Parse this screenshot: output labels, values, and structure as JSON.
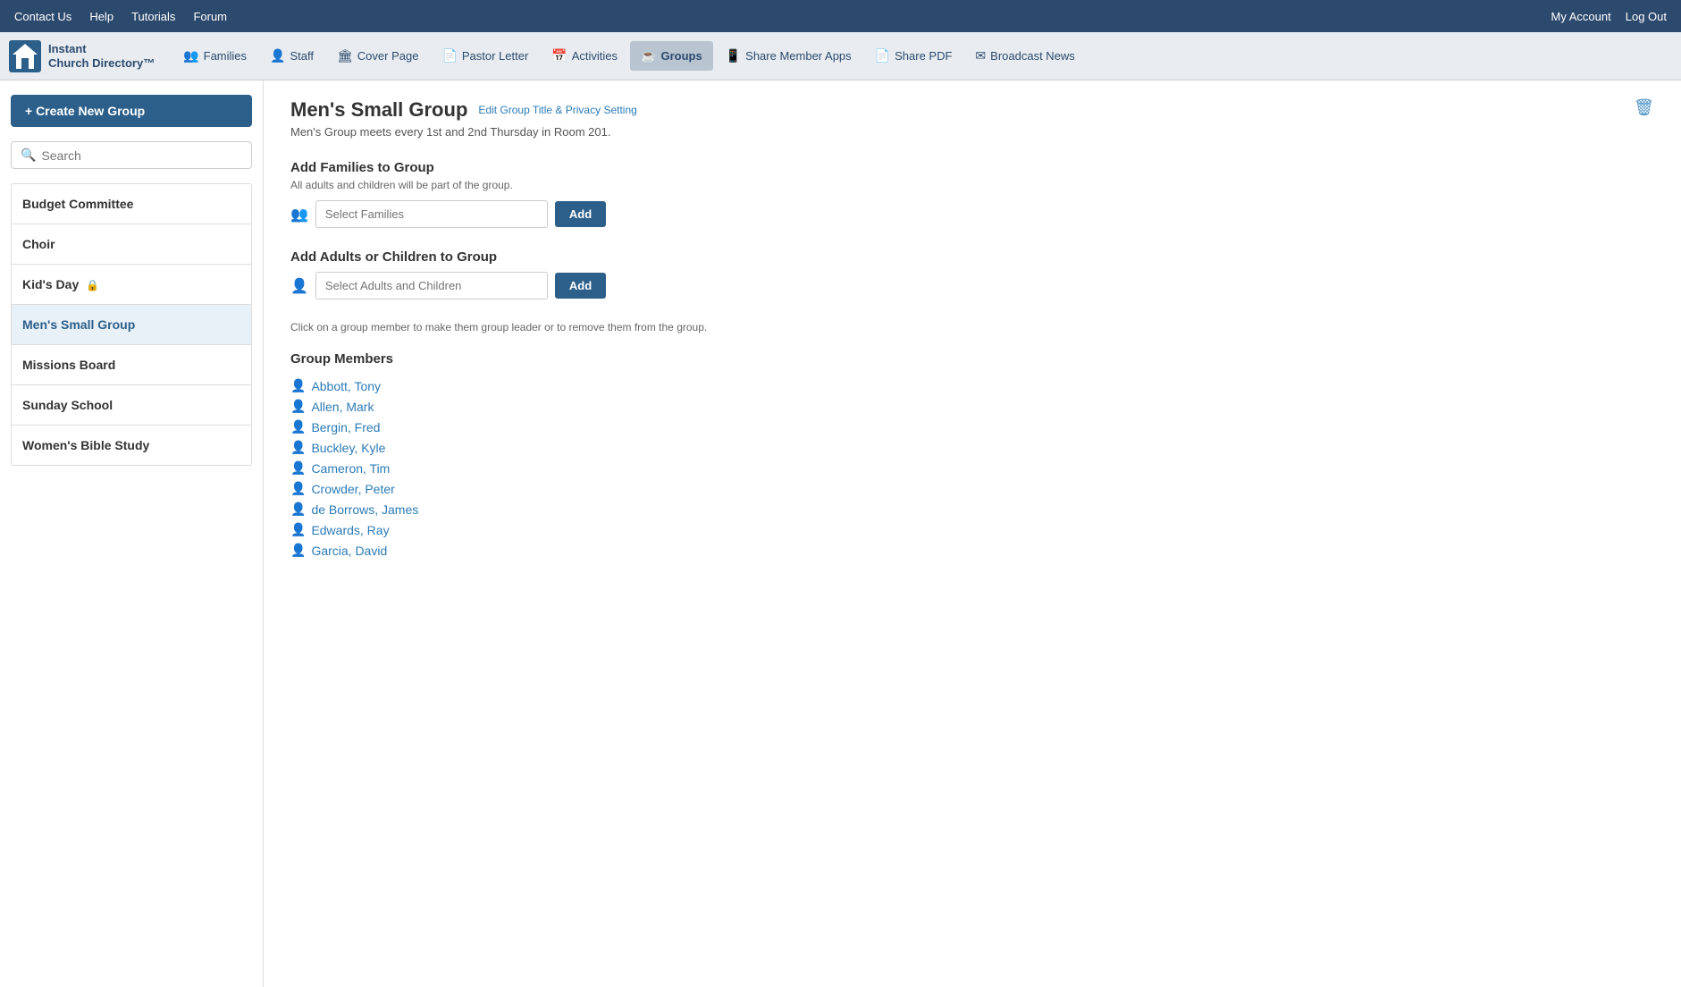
{
  "topNav": {
    "left": [
      "Contact Us",
      "Help",
      "Tutorials",
      "Forum"
    ],
    "right": [
      "My Account",
      "Log Out"
    ]
  },
  "mainNav": {
    "logoLine1": "Instant",
    "logoLine2": "Church Directory™",
    "items": [
      {
        "label": "Families",
        "icon": "👥",
        "active": false
      },
      {
        "label": "Staff",
        "icon": "👤",
        "active": false
      },
      {
        "label": "Cover Page",
        "icon": "🏛",
        "active": false
      },
      {
        "label": "Pastor Letter",
        "icon": "📄",
        "active": false
      },
      {
        "label": "Activities",
        "icon": "📅",
        "active": false
      },
      {
        "label": "Groups",
        "icon": "☕",
        "active": true
      },
      {
        "label": "Share Member Apps",
        "icon": "📱",
        "active": false
      },
      {
        "label": "Share PDF",
        "icon": "📄",
        "active": false
      },
      {
        "label": "Broadcast News",
        "icon": "✉",
        "active": false
      }
    ]
  },
  "sidebar": {
    "createButton": "+ Create New Group",
    "search": {
      "placeholder": "Search"
    },
    "groups": [
      {
        "name": "Budget Committee",
        "lock": false,
        "active": false
      },
      {
        "name": "Choir",
        "lock": false,
        "active": false
      },
      {
        "name": "Kid's Day",
        "lock": true,
        "active": false
      },
      {
        "name": "Men's Small Group",
        "lock": false,
        "active": true
      },
      {
        "name": "Missions Board",
        "lock": false,
        "active": false
      },
      {
        "name": "Sunday School",
        "lock": false,
        "active": false
      },
      {
        "name": "Women's Bible Study",
        "lock": false,
        "active": false
      }
    ]
  },
  "main": {
    "groupTitle": "Men's Small Group",
    "editLink": "Edit Group Title & Privacy Setting",
    "description": "Men's Group meets every 1st and 2nd Thursday in Room 201.",
    "addFamilies": {
      "sectionTitle": "Add Families to Group",
      "sectionSubtitle": "All adults and children will be part of the group.",
      "inputPlaceholder": "Select Families",
      "buttonLabel": "Add"
    },
    "addAdults": {
      "sectionTitle": "Add Adults or Children to Group",
      "inputPlaceholder": "Select Adults and Children",
      "buttonLabel": "Add"
    },
    "clickHint": "Click on a group member to make them group leader or to remove them from the group.",
    "membersTitle": "Group Members",
    "members": [
      "Abbott, Tony",
      "Allen, Mark",
      "Bergin, Fred",
      "Buckley, Kyle",
      "Cameron, Tim",
      "Crowder, Peter",
      "de Borrows, James",
      "Edwards, Ray",
      "Garcia, David"
    ]
  }
}
